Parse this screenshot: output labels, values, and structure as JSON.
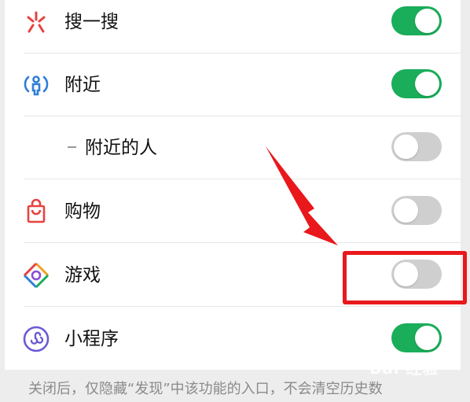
{
  "settings": {
    "items": [
      {
        "label": "搜一搜",
        "icon": "search-spark-icon",
        "enabled": true
      },
      {
        "label": "附近",
        "icon": "nearby-person-icon",
        "enabled": true
      },
      {
        "label": "附近的人",
        "icon": "",
        "enabled": false,
        "sub": true
      },
      {
        "label": "购物",
        "icon": "shopping-bag-icon",
        "enabled": false
      },
      {
        "label": "游戏",
        "icon": "game-diamond-icon",
        "enabled": false
      },
      {
        "label": "小程序",
        "icon": "mini-program-icon",
        "enabled": true
      }
    ]
  },
  "footer": {
    "note": "关闭后，仅隐藏“发现”中该功能的入口，不会清空历史数"
  },
  "colors": {
    "toggle_on": "#1aad5a",
    "toggle_off": "#cfcfcf",
    "annotation_red": "#e8181c"
  },
  "watermark": {
    "text": "Bai 经验"
  }
}
